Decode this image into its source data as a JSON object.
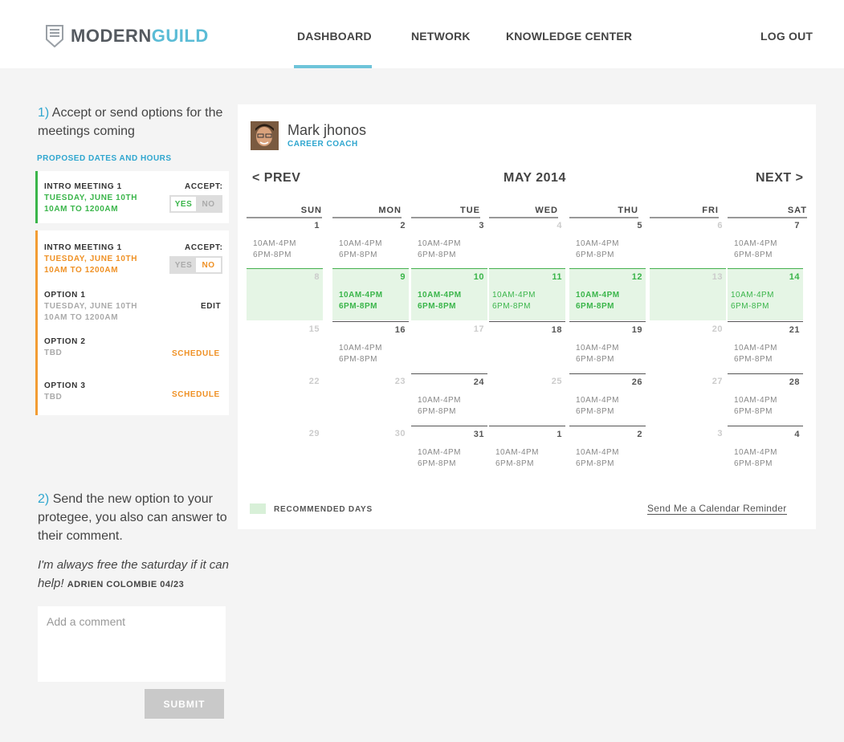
{
  "brand": {
    "part1": "MODERN",
    "part2": "GUILD"
  },
  "nav": {
    "dashboard": "DASHBOARD",
    "network": "NETWORK",
    "knowledge": "KNOWLEDGE CENTER",
    "logout": "LOG OUT"
  },
  "step1": {
    "num": "1)",
    "text": "Accept or send options for the meetings coming"
  },
  "proposed_label": "PROPOSED DATES AND HOURS",
  "meeting1": {
    "title": "INTRO MEETING 1",
    "date": "TUESDAY, JUNE 10TH",
    "time": "10AM TO 1200AM",
    "accept": "ACCEPT:",
    "yes": "YES",
    "no": "NO",
    "selected": "YES"
  },
  "meeting2": {
    "title": "INTRO MEETING 1",
    "date": "TUESDAY, JUNE 10TH",
    "time": "10AM TO 1200AM",
    "accept": "ACCEPT:",
    "yes": "YES",
    "no": "NO",
    "selected": "NO"
  },
  "options": [
    {
      "title": "OPTION 1",
      "line1": "TUESDAY, JUNE 10TH",
      "line2": "10AM TO 1200AM",
      "action": "EDIT"
    },
    {
      "title": "OPTION 2",
      "line1": "TBD",
      "line2": "",
      "action": "SCHEDULE"
    },
    {
      "title": "OPTION 3",
      "line1": "TBD",
      "line2": "",
      "action": "SCHEDULE"
    }
  ],
  "step2": {
    "num": "2)",
    "text": "Send the new option to your protegee, you also can answer to their comment."
  },
  "comment": {
    "text": "I'm always free the saturday if it can help!",
    "author": "ADRIEN COLOMBIE 04/23"
  },
  "comment_input": {
    "placeholder": "Add a comment",
    "value": ""
  },
  "submit_label": "SUBMIT",
  "coach": {
    "name": "Mark jhonos",
    "role": "CAREER COACH"
  },
  "calendar": {
    "prev": "< PREV",
    "month": "MAY 2014",
    "next": "NEXT >",
    "days_of_week": [
      "SUN",
      "MON",
      "TUE",
      "WED",
      "THU",
      "FRI",
      "SAT"
    ],
    "weeks": [
      [
        {
          "d": "1",
          "s1": "10AM-4PM",
          "s2": "6PM-8PM",
          "faded": false,
          "rec": false
        },
        {
          "d": "2",
          "s1": "10AM-4PM",
          "s2": "6PM-8PM",
          "faded": false,
          "rec": false
        },
        {
          "d": "3",
          "s1": "10AM-4PM",
          "s2": "6PM-8PM",
          "faded": false,
          "rec": false
        },
        {
          "d": "4",
          "s1": "",
          "s2": "",
          "faded": true,
          "rec": false
        },
        {
          "d": "5",
          "s1": "10AM-4PM",
          "s2": "6PM-8PM",
          "faded": false,
          "rec": false
        },
        {
          "d": "6",
          "s1": "",
          "s2": "",
          "faded": true,
          "rec": false
        },
        {
          "d": "7",
          "s1": "10AM-4PM",
          "s2": "6PM-8PM",
          "faded": false,
          "rec": false
        }
      ],
      [
        {
          "d": "8",
          "s1": "",
          "s2": "",
          "faded": true,
          "rec": true
        },
        {
          "d": "9",
          "s1": "10AM-4PM",
          "s2": "6PM-8PM",
          "faded": false,
          "rec": true,
          "bold": true
        },
        {
          "d": "10",
          "s1": "10AM-4PM",
          "s2": "6PM-8PM",
          "faded": false,
          "rec": true,
          "bold": true
        },
        {
          "d": "11",
          "s1": "10AM-4PM",
          "s2": "6PM-8PM",
          "faded": false,
          "rec": true,
          "bold": false
        },
        {
          "d": "12",
          "s1": "10AM-4PM",
          "s2": "6PM-8PM",
          "faded": false,
          "rec": true,
          "bold": true
        },
        {
          "d": "13",
          "s1": "",
          "s2": "",
          "faded": true,
          "rec": true
        },
        {
          "d": "14",
          "s1": "10AM-4PM",
          "s2": "6PM-8PM",
          "faded": false,
          "rec": true,
          "bold": false
        }
      ],
      [
        {
          "d": "15",
          "s1": "",
          "s2": "",
          "faded": true,
          "rec": false
        },
        {
          "d": "16",
          "s1": "10AM-4PM",
          "s2": "6PM-8PM",
          "faded": false,
          "rec": false
        },
        {
          "d": "17",
          "s1": "",
          "s2": "",
          "faded": true,
          "rec": false
        },
        {
          "d": "18",
          "s1": "",
          "s2": "",
          "faded": false,
          "rec": false
        },
        {
          "d": "19",
          "s1": "10AM-4PM",
          "s2": "6PM-8PM",
          "faded": false,
          "rec": false
        },
        {
          "d": "20",
          "s1": "",
          "s2": "",
          "faded": true,
          "rec": false
        },
        {
          "d": "21",
          "s1": "10AM-4PM",
          "s2": "6PM-8PM",
          "faded": false,
          "rec": false
        }
      ],
      [
        {
          "d": "22",
          "s1": "",
          "s2": "",
          "faded": true,
          "rec": false
        },
        {
          "d": "23",
          "s1": "",
          "s2": "",
          "faded": true,
          "rec": false
        },
        {
          "d": "24",
          "s1": "10AM-4PM",
          "s2": "6PM-8PM",
          "faded": false,
          "rec": false
        },
        {
          "d": "25",
          "s1": "",
          "s2": "",
          "faded": true,
          "rec": false
        },
        {
          "d": "26",
          "s1": "10AM-4PM",
          "s2": "6PM-8PM",
          "faded": false,
          "rec": false
        },
        {
          "d": "27",
          "s1": "",
          "s2": "",
          "faded": true,
          "rec": false
        },
        {
          "d": "28",
          "s1": "10AM-4PM",
          "s2": "6PM-8PM",
          "faded": false,
          "rec": false
        }
      ],
      [
        {
          "d": "29",
          "s1": "",
          "s2": "",
          "faded": true,
          "rec": false
        },
        {
          "d": "30",
          "s1": "",
          "s2": "",
          "faded": true,
          "rec": false
        },
        {
          "d": "31",
          "s1": "10AM-4PM",
          "s2": "6PM-8PM",
          "faded": false,
          "rec": false
        },
        {
          "d": "1",
          "s1": "10AM-4PM",
          "s2": "6PM-8PM",
          "faded": false,
          "rec": false
        },
        {
          "d": "2",
          "s1": "10AM-4PM",
          "s2": "6PM-8PM",
          "faded": false,
          "rec": false
        },
        {
          "d": "3",
          "s1": "",
          "s2": "",
          "faded": true,
          "rec": false
        },
        {
          "d": "4",
          "s1": "10AM-4PM",
          "s2": "6PM-8PM",
          "faded": false,
          "rec": false
        }
      ]
    ]
  },
  "legend": "RECOMMENDED DAYS",
  "reminder_link": "Send Me a Calendar Reminder",
  "colors": {
    "accent_blue": "#2fa6cf",
    "green": "#3ab54a",
    "orange": "#ef9125",
    "recommended_bg": "#e5f5e5"
  }
}
